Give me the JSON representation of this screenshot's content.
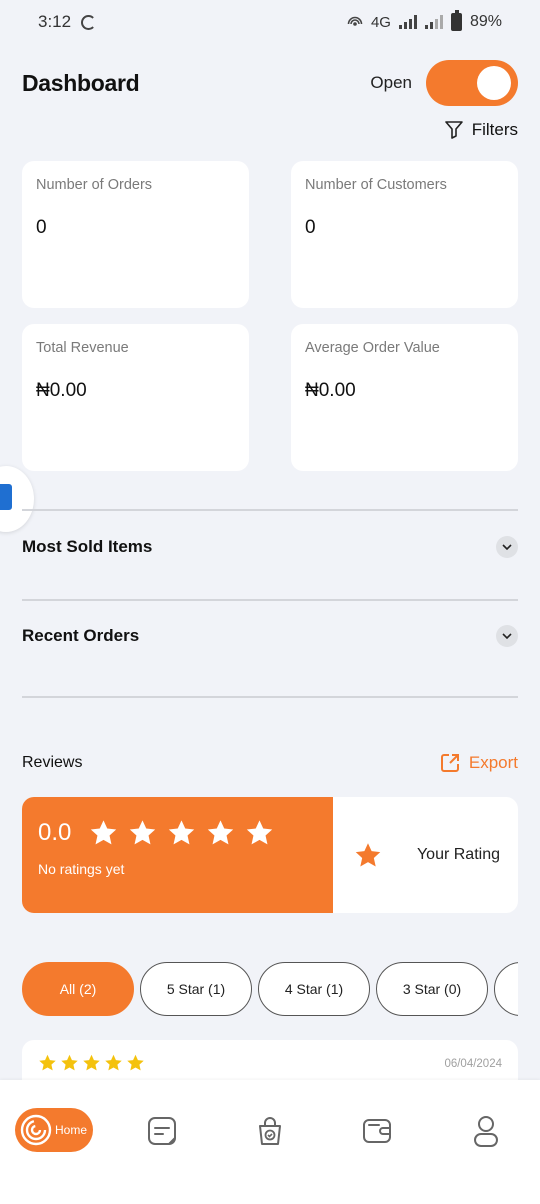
{
  "status_bar": {
    "time": "3:12",
    "network": "4G",
    "battery": "89%"
  },
  "header": {
    "title": "Dashboard",
    "open_label": "Open",
    "open_toggle_on": true
  },
  "filters": {
    "label": "Filters"
  },
  "stats": [
    {
      "label": "Number of Orders",
      "value": "0"
    },
    {
      "label": "Number of Customers",
      "value": "0"
    },
    {
      "label": "Total Revenue",
      "value": "₦0.00"
    },
    {
      "label": "Average Order Value",
      "value": "₦0.00"
    }
  ],
  "sections": {
    "most_sold": "Most Sold Items",
    "recent_orders": "Recent Orders"
  },
  "reviews": {
    "title": "Reviews",
    "export_label": "Export",
    "average": "0.0",
    "no_ratings": "No ratings yet",
    "your_rating": "Your Rating",
    "filters": [
      "All (2)",
      "5 Star (1)",
      "4 Star (1)",
      "3 Star (0)"
    ],
    "first_review_date": "06/04/2024",
    "first_review_stars": 5
  },
  "bottom_nav": {
    "home_label": "Home"
  },
  "colors": {
    "accent": "#f47a2d",
    "background": "#f1f3f8",
    "star_yellow": "#f4c20d"
  },
  "icons": [
    "filter-icon",
    "export-icon",
    "star-icon",
    "chevron-down-icon",
    "home-icon",
    "orders-icon",
    "bag-icon",
    "wallet-icon",
    "profile-icon"
  ]
}
